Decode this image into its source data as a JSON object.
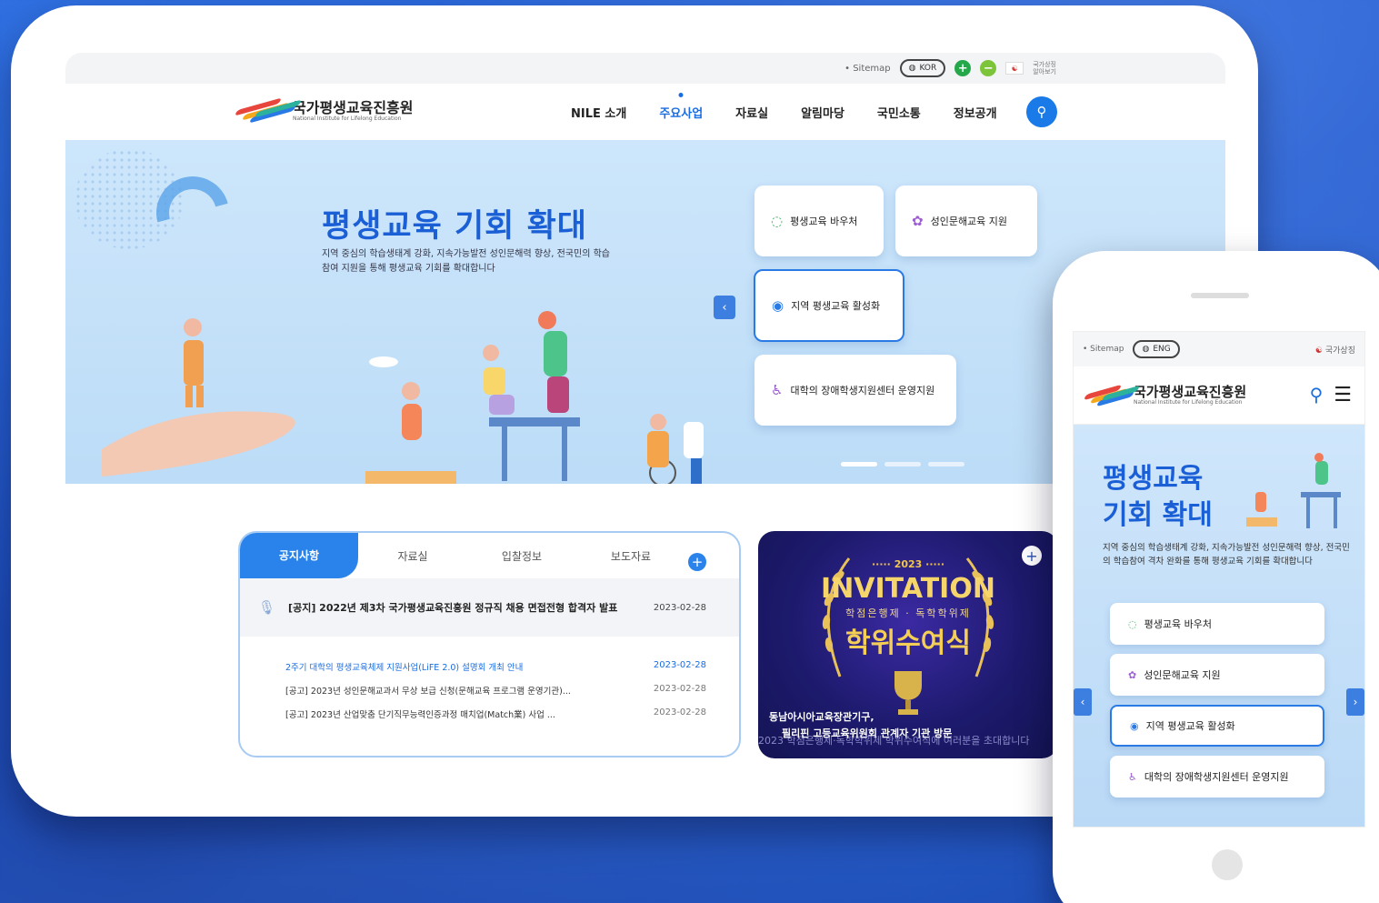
{
  "tablet": {
    "util": {
      "sitemap": "• Sitemap",
      "lang": "KOR",
      "zoom_in": "+",
      "zoom_out": "−",
      "gov_line1": "국가상징",
      "gov_line2": "알아보기"
    },
    "logo": {
      "name": "국가평생교육진흥원",
      "sub": "National Institute for Lifelong Education"
    },
    "menu": [
      "NILE 소개",
      "주요사업",
      "자료실",
      "알림마당",
      "국민소통",
      "정보공개"
    ],
    "menu_active_index": 1,
    "hero": {
      "title": "평생교육 기회 확대",
      "desc": "지역 중심의 학습생태계 강화, 지속가능발전 성인문해력 향상, 전국민의 학습참여 지원을 통해 평생교육 기회를 확대합니다",
      "cards": [
        {
          "label": "평생교육 바우처",
          "icon": "chat-bubble-icon"
        },
        {
          "label": "성인문해교육 지원",
          "icon": "people-icon"
        },
        {
          "label": "지역 평생교육 활성화",
          "icon": "location-pin-icon"
        },
        {
          "label": "대학의 장애학생지원센터 운영지원",
          "icon": "wheelchair-icon"
        }
      ],
      "selected_card_index": 2
    },
    "board": {
      "tabs": [
        "공지사항",
        "자료실",
        "입찰정보",
        "보도자료"
      ],
      "active_tab_index": 0,
      "plus": "+",
      "top_notice": {
        "title": "[공지] 2022년 제3차 국가평생교육진흥원 정규직 채용 면접전형 합격자 발표",
        "date": "2023-02-28"
      },
      "rows": [
        {
          "title": "2주기 대학의 평생교육체제 지원사업(LiFE 2.0) 설명회 개최 안내",
          "date": "2023-02-28",
          "highlight": true
        },
        {
          "title": "[공고] 2023년 성인문해교과서 무상 보급 신청(문해교육 프로그램 운영기관)...",
          "date": "2023-02-28",
          "highlight": false
        },
        {
          "title": "[공고] 2023년 산업맞춤 단기직무능력인증과정 매치업(Match業) 사업 ...",
          "date": "2023-02-28",
          "highlight": false
        }
      ]
    },
    "banner": {
      "year": "····· 2023 ·····",
      "invitation": "INVITATION",
      "sub": "학점은행제 · 독학학위제",
      "big": "학위수여식",
      "caption1": "동남아시아교육장관기구,",
      "caption2": "필리핀 고등교육위원회 관계자 기관 방문",
      "caption2_fade": "2023 학점은행제·독학학위제 학위수여식에 여러분을 초대합니다",
      "plus": "+"
    }
  },
  "phone": {
    "util": {
      "sitemap": "• Sitemap",
      "lang": "ENG",
      "gov": "국가상징"
    },
    "logo": {
      "name": "국가평생교육진흥원",
      "sub": "National Institute for Lifelong Education"
    },
    "hero": {
      "title_line1": "평생교육",
      "title_line2": "기회 확대",
      "desc": "지역 중심의 학습생태계 강화, 지속가능발전 성인문해력 향상, 전국민의 학습참여 격차 완화를 통해 평생교육 기회를 확대합니다",
      "cards": [
        {
          "label": "평생교육 바우처"
        },
        {
          "label": "성인문해교육 지원"
        },
        {
          "label": "지역 평생교육 활성화"
        },
        {
          "label": "대학의 장애학생지원센터 운영지원"
        }
      ],
      "selected_card_index": 2
    }
  },
  "colors": {
    "brand_blue": "#1a6de0",
    "accent": "#2a83ea",
    "background": "#2f6fe0",
    "gold": "#f5cf55"
  }
}
